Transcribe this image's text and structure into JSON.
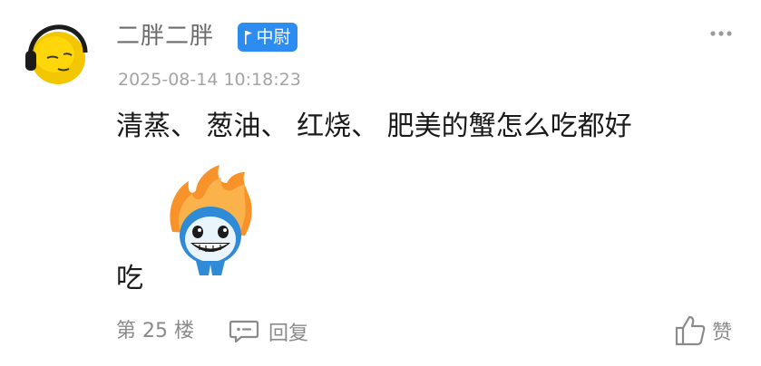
{
  "post": {
    "username": "二胖二胖",
    "badge": "中尉",
    "timestamp": "2025-08-14 10:18:23",
    "content_line1": "清蒸、 葱油、 红烧、 肥美的蟹怎么吃都好",
    "content_line2": "吃",
    "floor": "第 25 楼",
    "reply_label": "回复",
    "like_label": "赞"
  },
  "icons": {
    "avatar": "yellow-face-headphones-avatar",
    "badge_flag": "flag-icon",
    "more": "more-dots-icon",
    "emoji": "flame-hair-grinning-emoji",
    "reply": "comment-bubble-icon",
    "like": "thumbs-up-icon"
  },
  "colors": {
    "badge_bg": "#2d8cf0",
    "username": "#6c6c6c",
    "timestamp": "#a4a4a4",
    "content": "#1a1a1a",
    "footer": "#8a8a8a"
  }
}
